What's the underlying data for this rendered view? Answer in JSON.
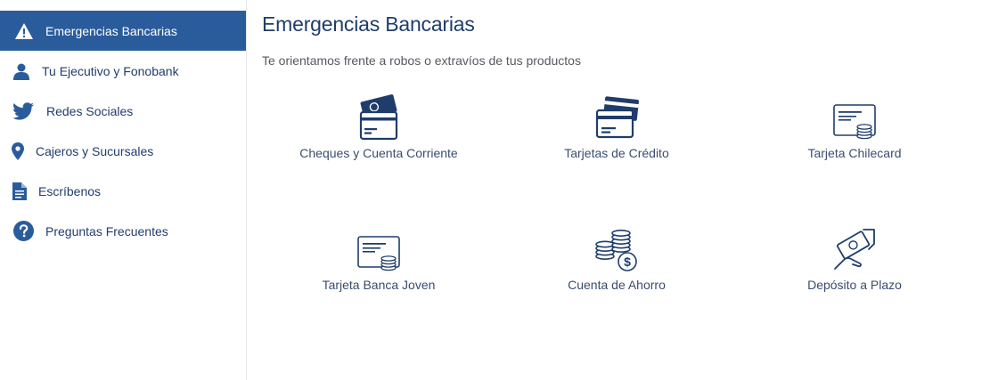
{
  "sidebar": {
    "items": [
      {
        "label": "Emergencias Bancarias",
        "icon": "warning-icon",
        "active": true
      },
      {
        "label": "Tu Ejecutivo y Fonobank",
        "icon": "person-icon",
        "active": false
      },
      {
        "label": "Redes Sociales",
        "icon": "twitter-icon",
        "active": false
      },
      {
        "label": "Cajeros y Sucursales",
        "icon": "location-pin-icon",
        "active": false
      },
      {
        "label": "Escríbenos",
        "icon": "document-icon",
        "active": false
      },
      {
        "label": "Preguntas Frecuentes",
        "icon": "help-circle-icon",
        "active": false
      }
    ]
  },
  "main": {
    "title": "Emergencias Bancarias",
    "subtitle": "Te orientamos frente a robos o extravíos de tus productos",
    "products": [
      {
        "label": "Cheques y Cuenta Corriente",
        "icon": "cheque-cards-icon"
      },
      {
        "label": "Tarjetas de Crédito",
        "icon": "credit-cards-icon"
      },
      {
        "label": "Tarjeta Chilecard",
        "icon": "card-coins-icon"
      },
      {
        "label": "Tarjeta Banca Joven",
        "icon": "card-coins-icon"
      },
      {
        "label": "Cuenta de Ahorro",
        "icon": "coins-stack-icon"
      },
      {
        "label": "Depósito a Plazo",
        "icon": "hand-money-icon"
      }
    ]
  },
  "colors": {
    "brand": "#2a5c9c",
    "dark_blue": "#1f3d6b",
    "text": "#555a60"
  }
}
